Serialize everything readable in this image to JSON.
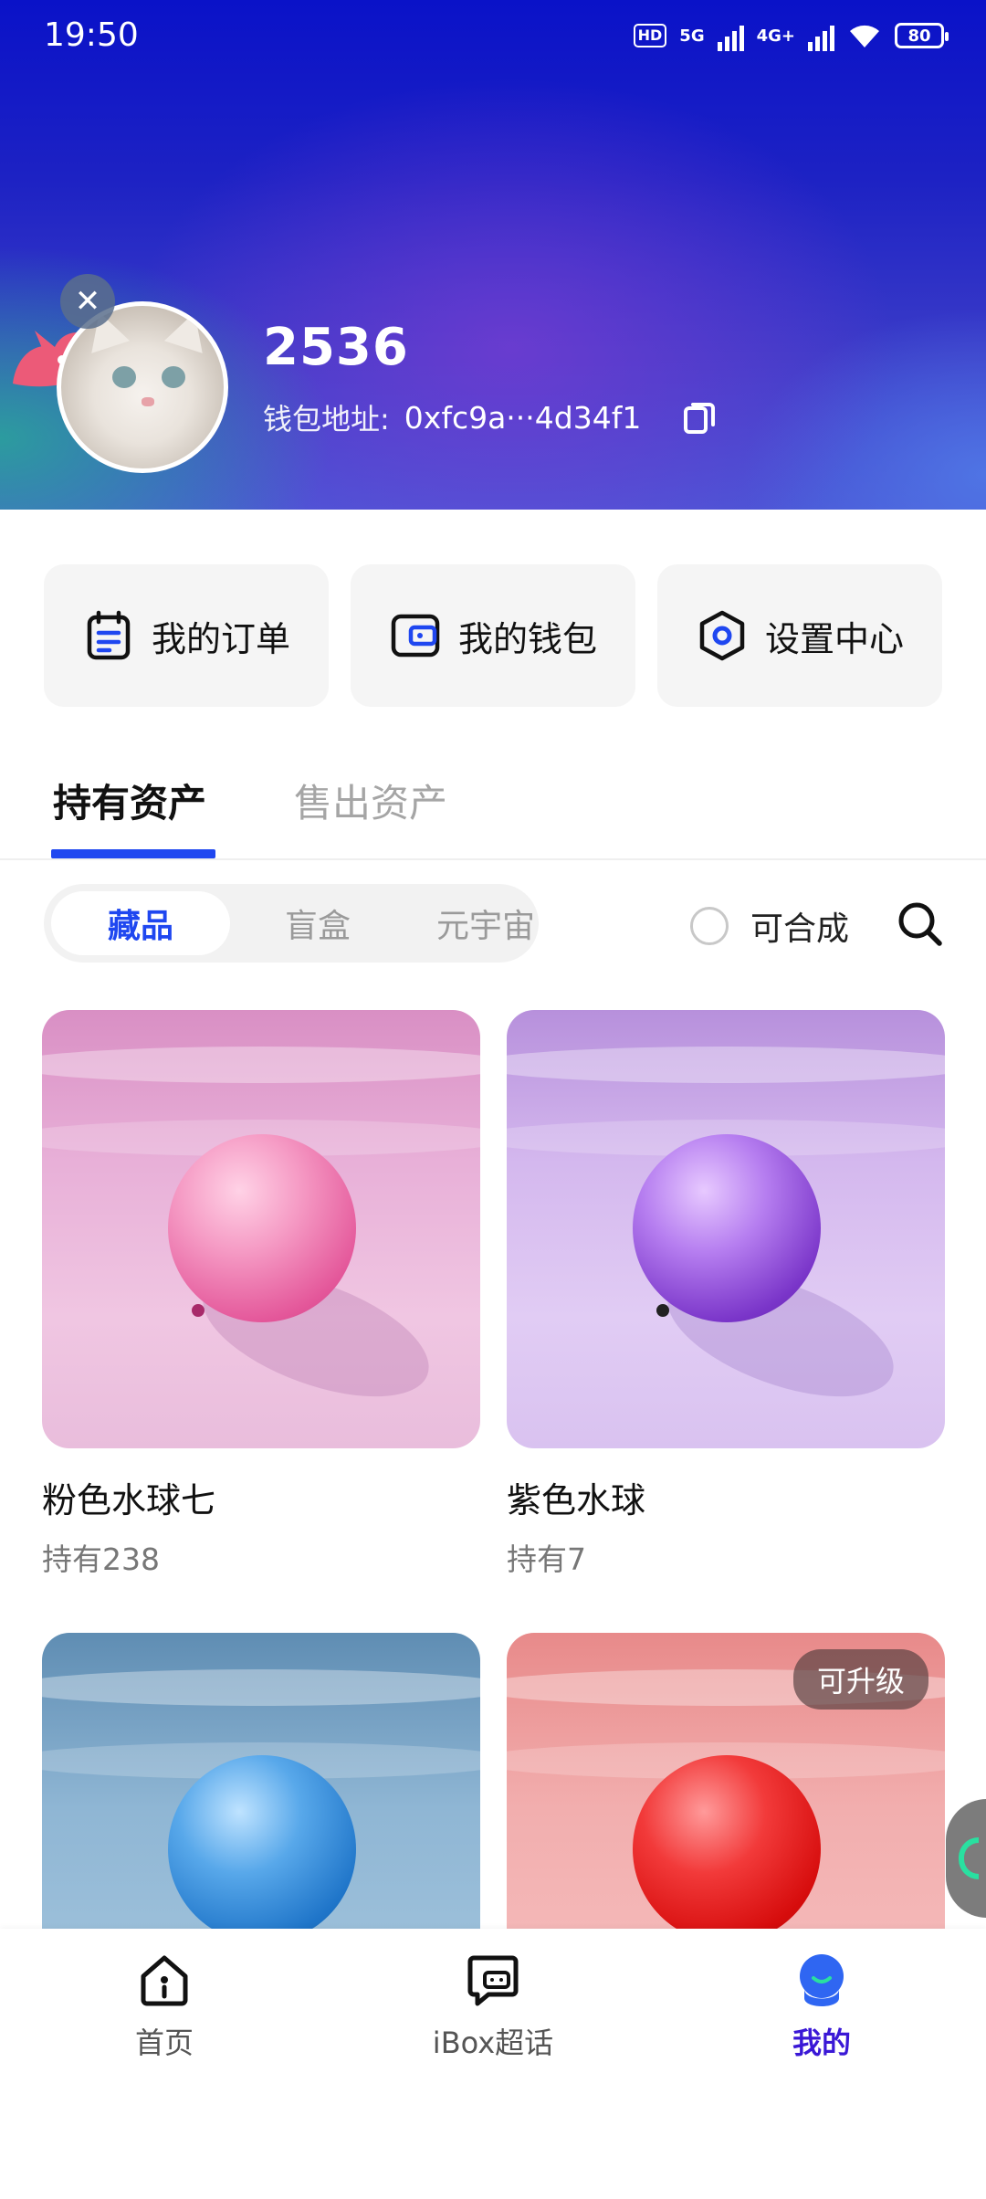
{
  "status_bar": {
    "time": "19:50",
    "network_1": "5G",
    "network_2": "4G+",
    "hd_label": "HD",
    "battery": "80"
  },
  "profile": {
    "username": "2536",
    "wallet_label": "钱包地址:",
    "wallet_address": "0xfc9a···4d34f1",
    "avatar_icon": "cat-avatar",
    "close_icon": "close-icon"
  },
  "actions": [
    {
      "label": "我的订单",
      "icon": "orders-icon",
      "color": "#1f47f0"
    },
    {
      "label": "我的钱包",
      "icon": "wallet-icon",
      "color": "#1f47f0"
    },
    {
      "label": "设置中心",
      "icon": "settings-icon",
      "color": "#1f47f0"
    }
  ],
  "tabs": {
    "active": "持有资产",
    "inactive": "售出资产",
    "accent": "#1f47f0"
  },
  "filters": {
    "segments": [
      "藏品",
      "盲盒",
      "元宇宙"
    ],
    "selected": "藏品",
    "synth_label": "可合成",
    "synth_checked": false
  },
  "cards": [
    {
      "title": "粉色水球七",
      "holding": "持有238",
      "theme": "pink"
    },
    {
      "title": "紫色水球",
      "holding": "持有7",
      "theme": "purple"
    },
    {
      "title": "",
      "holding": "",
      "theme": "blue"
    },
    {
      "title": "",
      "holding": "",
      "theme": "red",
      "tag": "可升级"
    }
  ],
  "bottom_nav": [
    {
      "label": "首页",
      "icon": "home-icon",
      "active": false
    },
    {
      "label": "iBox超话",
      "icon": "chat-icon",
      "active": false
    },
    {
      "label": "我的",
      "icon": "profile-icon",
      "active": true
    }
  ]
}
